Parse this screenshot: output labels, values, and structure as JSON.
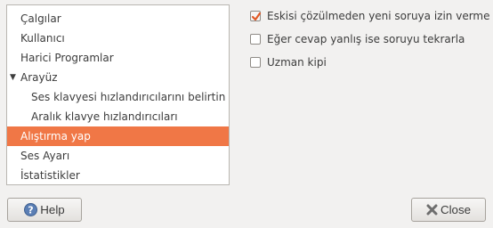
{
  "tree": {
    "items": [
      {
        "label": "Çalgılar",
        "level": 0,
        "expanded": null,
        "selected": false
      },
      {
        "label": "Kullanıcı",
        "level": 0,
        "expanded": null,
        "selected": false
      },
      {
        "label": "Harici Programlar",
        "level": 0,
        "expanded": null,
        "selected": false
      },
      {
        "label": "Arayüz",
        "level": 0,
        "expanded": true,
        "selected": false
      },
      {
        "label": "Ses klavyesi hızlandırıcılarını belirtin",
        "level": 1,
        "expanded": null,
        "selected": false
      },
      {
        "label": "Aralık klavye hızlandırıcıları",
        "level": 1,
        "expanded": null,
        "selected": false
      },
      {
        "label": "Alıştırma yap",
        "level": 0,
        "expanded": null,
        "selected": true
      },
      {
        "label": "Ses Ayarı",
        "level": 0,
        "expanded": null,
        "selected": false
      },
      {
        "label": "İstatistikler",
        "level": 0,
        "expanded": null,
        "selected": false
      }
    ]
  },
  "options": [
    {
      "label": "Eskisi çözülmeden yeni soruya izin verme",
      "checked": true
    },
    {
      "label": "Eğer cevap yanlış ise soruyu tekrarla",
      "checked": false
    },
    {
      "label": "Uzman kipi",
      "checked": false
    }
  ],
  "buttons": {
    "help_label": "Help",
    "close_label": "Close"
  },
  "colors": {
    "selection": "#f07746",
    "check_mark": "#e15a27",
    "help_icon": "#5b7fb5",
    "close_icon": "#6e6e6e"
  },
  "icons": {
    "expander": "triangle-down-icon",
    "help": "help-icon",
    "close": "close-x-icon",
    "checkbox": "check-icon"
  }
}
